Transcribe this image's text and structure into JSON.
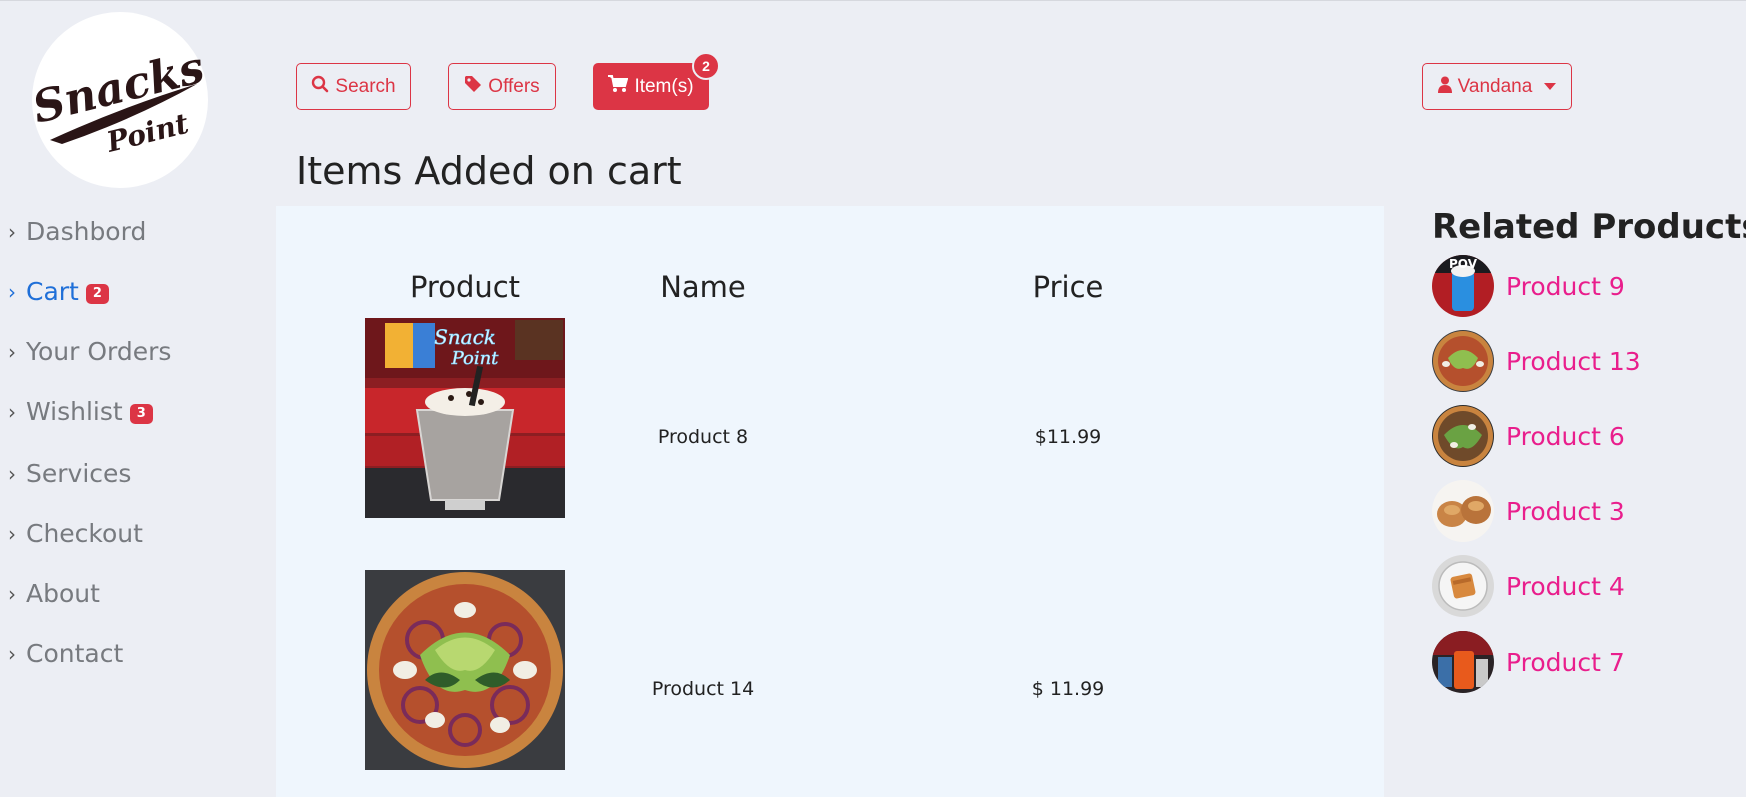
{
  "logo": {
    "line1": "Snacks",
    "line2": "Point"
  },
  "sidebar": {
    "items": [
      {
        "label": "Dashbord",
        "badge": null,
        "active": false
      },
      {
        "label": "Cart",
        "badge": "2",
        "active": true
      },
      {
        "label": "Your Orders",
        "badge": null,
        "active": false
      },
      {
        "label": "Wishlist",
        "badge": "3",
        "active": false
      },
      {
        "label": "Services",
        "badge": null,
        "active": false
      },
      {
        "label": "Checkout",
        "badge": null,
        "active": false
      },
      {
        "label": "About",
        "badge": null,
        "active": false
      },
      {
        "label": "Contact",
        "badge": null,
        "active": false
      }
    ]
  },
  "toolbar": {
    "search_label": "Search",
    "offers_label": "Offers",
    "items_label": "Item(s)",
    "items_count": "2",
    "user_label": "Vandana"
  },
  "page_title": "Items Added on cart",
  "cart": {
    "headers": {
      "product": "Product",
      "name": "Name",
      "price": "Price"
    },
    "rows": [
      {
        "name": "Product 8",
        "price": "$11.99",
        "image": "milkshake"
      },
      {
        "name": "Product 14",
        "price": "$ 11.99",
        "image": "pizza"
      }
    ]
  },
  "related": {
    "title": "Related Products",
    "items": [
      {
        "label": "Product 9",
        "image": "blue-drink"
      },
      {
        "label": "Product 13",
        "image": "pizza"
      },
      {
        "label": "Product 6",
        "image": "pizza"
      },
      {
        "label": "Product 3",
        "image": "pastries"
      },
      {
        "label": "Product 4",
        "image": "toast-plate"
      },
      {
        "label": "Product 7",
        "image": "orange-drink"
      }
    ]
  },
  "colors": {
    "accent": "#dc3545",
    "active_link": "#1f6fd8",
    "related_link": "#e91e8c",
    "panel_bg": "#eff6fd",
    "page_bg": "#eceef4"
  }
}
